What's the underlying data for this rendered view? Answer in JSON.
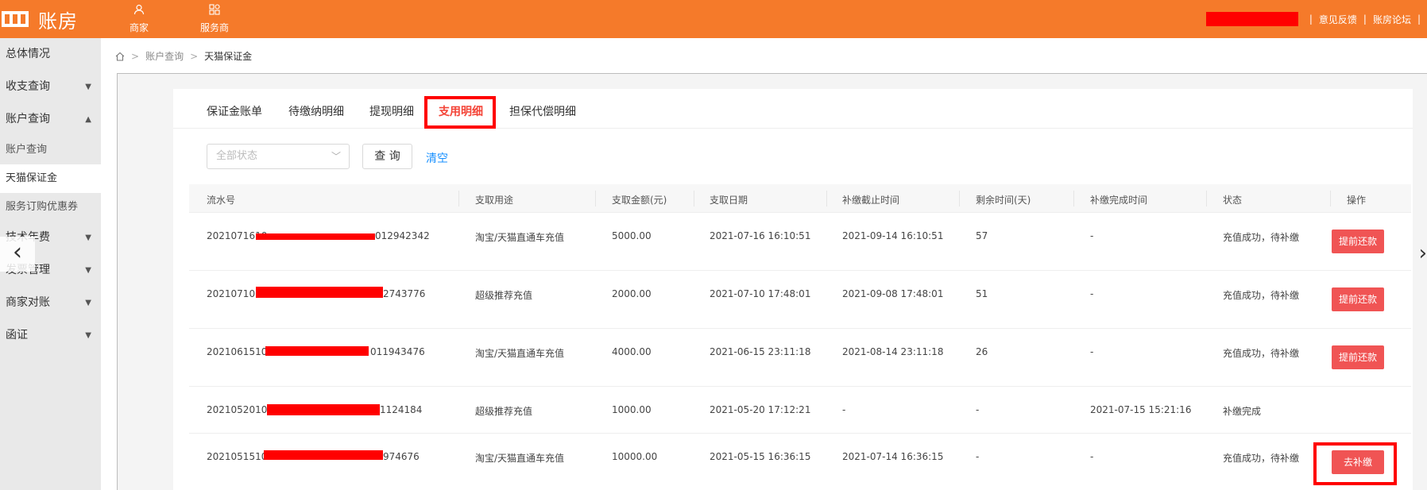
{
  "app": {
    "title": "账房"
  },
  "topnav": [
    {
      "label": "商家",
      "icon": "user-icon"
    },
    {
      "label": "服务商",
      "icon": "grid-icon"
    }
  ],
  "top_links": {
    "feedback": "意见反馈",
    "forum": "账房论坛",
    "sep": "|"
  },
  "sidebar": {
    "items": [
      {
        "label": "总体情况"
      },
      {
        "label": "收支查询"
      },
      {
        "label": "账户查询"
      },
      {
        "label": "账户查询"
      },
      {
        "label": "天猫保证金"
      },
      {
        "label": "服务订购优惠券"
      },
      {
        "label": "技术年费"
      },
      {
        "label": "发票管理"
      },
      {
        "label": "商家对账"
      },
      {
        "label": "函证"
      }
    ]
  },
  "breadcrumb": {
    "items": [
      "账户查询",
      "天猫保证金"
    ],
    "sep": ">"
  },
  "tabs": [
    {
      "label": "保证金账单"
    },
    {
      "label": "待缴纳明细"
    },
    {
      "label": "提现明细"
    },
    {
      "label": "支用明细",
      "active": true
    },
    {
      "label": "担保代偿明细"
    }
  ],
  "filters": {
    "status_placeholder": "全部状态",
    "query_label": "查 询",
    "clear_label": "清空"
  },
  "table": {
    "columns": [
      "流水号",
      "支取用途",
      "支取金额(元)",
      "支取日期",
      "补缴截止时间",
      "剩余时间(天)",
      "补缴完成时间",
      "状态",
      "操作"
    ],
    "rows": [
      {
        "serial_prefix": "2021071610",
        "serial_suffix": "012942342",
        "usage": "淘宝/天猫直通车充值",
        "amount": "5000.00",
        "date": "2021-07-16 16:10:51",
        "deadline": "2021-09-14 16:10:51",
        "remaining": "57",
        "completed": "-",
        "status": "充值成功，待补缴",
        "action": "提前还款"
      },
      {
        "serial_prefix": "2021071010",
        "serial_suffix": "2743776",
        "usage": "超级推荐充值",
        "amount": "2000.00",
        "date": "2021-07-10 17:48:01",
        "deadline": "2021-09-08 17:48:01",
        "remaining": "51",
        "completed": "-",
        "status": "充值成功，待补缴",
        "action": "提前还款"
      },
      {
        "serial_prefix": "2021061510",
        "serial_suffix": "011943476",
        "usage": "淘宝/天猫直通车充值",
        "amount": "4000.00",
        "date": "2021-06-15 23:11:18",
        "deadline": "2021-08-14 23:11:18",
        "remaining": "26",
        "completed": "-",
        "status": "充值成功，待补缴",
        "action": "提前还款"
      },
      {
        "serial_prefix": "2021052010",
        "serial_suffix": "1124184",
        "usage": "超级推荐充值",
        "amount": "1000.00",
        "date": "2021-05-20 17:12:21",
        "deadline": "-",
        "remaining": "-",
        "completed": "2021-07-15 15:21:16",
        "status": "补缴完成",
        "action": ""
      },
      {
        "serial_prefix": "2021051510",
        "serial_suffix": "974676",
        "usage": "淘宝/天猫直通车充值",
        "amount": "10000.00",
        "date": "2021-05-15 16:36:15",
        "deadline": "2021-07-14 16:36:15",
        "remaining": "-",
        "completed": "-",
        "status": "充值成功，待补缴",
        "action": "去补缴"
      }
    ]
  },
  "colors": {
    "brand": "#f57a2a",
    "danger": "#f05454",
    "highlight": "#ff0000",
    "link": "#1890ff"
  }
}
